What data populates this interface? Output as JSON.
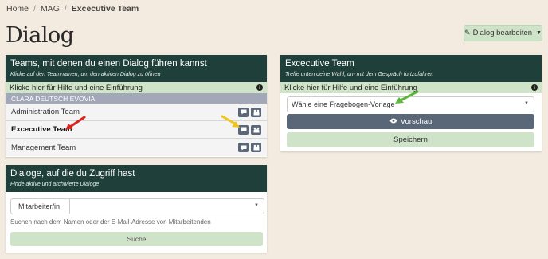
{
  "breadcrumb": {
    "home": "Home",
    "sep": "/",
    "mag": "MAG",
    "current": "Excecutive Team"
  },
  "page_title": "Dialog",
  "edit_button": {
    "label": "Dialog bearbeiten"
  },
  "teams_panel": {
    "title": "Teams, mit denen du einen Dialog führen kannst",
    "subtitle": "Klicke auf den Teamnamen, um den aktiven Dialog zu öffnen",
    "help": "Klicke hier für Hilfe und eine Einführung",
    "org": "CLARA DEUTSCH EVOVIA",
    "teams": [
      {
        "label": "Administration Team"
      },
      {
        "label": "Excecutive Team"
      },
      {
        "label": "Management Team"
      }
    ]
  },
  "dialogs_panel": {
    "title": "Dialoge, auf die du Zugriff hast",
    "subtitle": "Finde aktive und archivierte Dialoge",
    "select_label": "Mitarbeiter/in",
    "hint": "Suchen nach dem Namen oder der E-Mail-Adresse von Mitarbeitenden",
    "search_button": "Suche"
  },
  "exec_panel": {
    "title": "Excecutive Team",
    "subtitle": "Treffe unten deine Wahl, um mit dem Gespräch fortzufahren",
    "help": "Klicke hier für Hilfe und eine Einführung",
    "template_select": "Wähle eine Fragebogen-Vorlage",
    "preview_button": "Vorschau",
    "save_button": "Speichern"
  },
  "colors": {
    "header": "#1f3f3a",
    "accent_green": "#cfe3c9",
    "button_dark": "#5a6778",
    "background": "#f3ebe0",
    "arrow_red": "#d9231f",
    "arrow_yellow": "#f0c419",
    "arrow_green": "#5cb83a"
  }
}
